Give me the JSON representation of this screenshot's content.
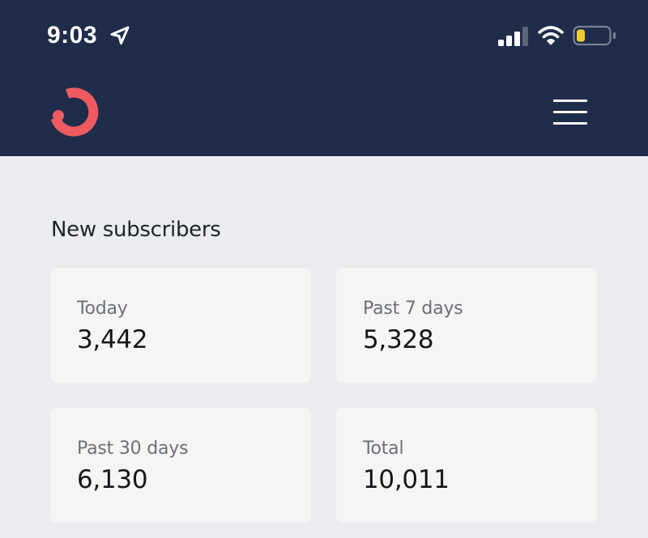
{
  "status_bar": {
    "time": "9:03"
  },
  "header": {
    "background_color": "#1f2c4a",
    "logo_color": "#ef5b61"
  },
  "section": {
    "title": "New subscribers"
  },
  "stats": [
    {
      "label": "Today",
      "value": "3,442"
    },
    {
      "label": "Past 7 days",
      "value": "5,328"
    },
    {
      "label": "Past 30 days",
      "value": "6,130"
    },
    {
      "label": "Total",
      "value": "10,011"
    }
  ],
  "colors": {
    "page_background": "#ebecf0",
    "card_background": "#f5f5f5",
    "battery_level": "#f2cc2b"
  }
}
